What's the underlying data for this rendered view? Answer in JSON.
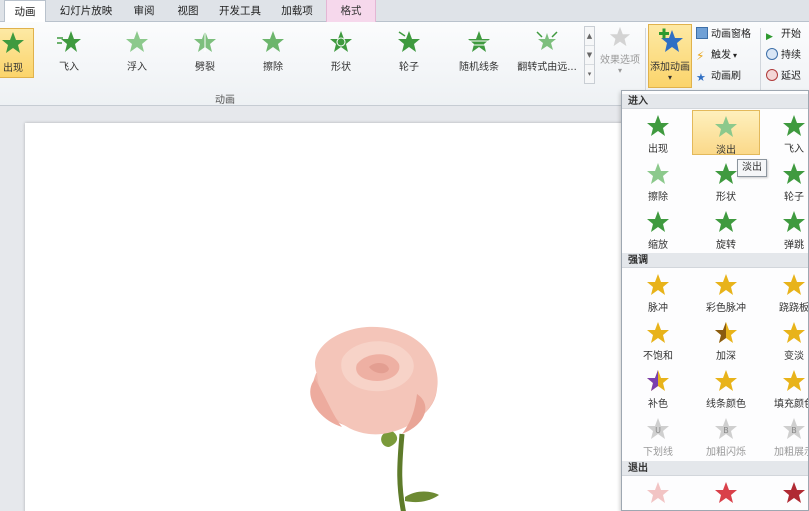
{
  "tabs": [
    {
      "label": "动画",
      "active": true
    },
    {
      "label": "幻灯片放映"
    },
    {
      "label": "审阅"
    },
    {
      "label": "视图"
    },
    {
      "label": "开发工具"
    },
    {
      "label": "加载项"
    },
    {
      "label": "格式"
    }
  ],
  "colors": {
    "enter": "#3f9a3f",
    "emphasis": "#e8b31a",
    "exit": "#c9343d",
    "accent": "#fbd46b"
  },
  "gallery": {
    "group_label": "动画",
    "items": [
      {
        "label": "出现",
        "selected": true
      },
      {
        "label": "飞入"
      },
      {
        "label": "浮入"
      },
      {
        "label": "劈裂"
      },
      {
        "label": "擦除"
      },
      {
        "label": "形状"
      },
      {
        "label": "轮子"
      },
      {
        "label": "随机线条"
      },
      {
        "label": "翻转式由远..."
      }
    ],
    "effects_label": "效果选项"
  },
  "advanced": {
    "add_animation": "添加动画",
    "pane": "动画窗格",
    "trigger": "触发",
    "painter": "动画刷"
  },
  "timing": {
    "start": "开始",
    "duration": "持续",
    "delay": "延迟"
  },
  "panel": {
    "tooltip": "淡出",
    "sections": [
      {
        "title": "进入",
        "items": [
          "出现",
          "淡出",
          "飞入",
          "擦除",
          "形状",
          "轮子",
          "缩放",
          "旋转",
          "弹跳"
        ]
      },
      {
        "title": "强调",
        "items": [
          "脉冲",
          "彩色脉冲",
          "跷跷板",
          "不饱和",
          "加深",
          "变淡",
          "补色",
          "线条颜色",
          "填充颜色",
          "下划线",
          "加粗闪烁",
          "加粗展示"
        ]
      },
      {
        "title": "退出",
        "items": []
      }
    ]
  }
}
